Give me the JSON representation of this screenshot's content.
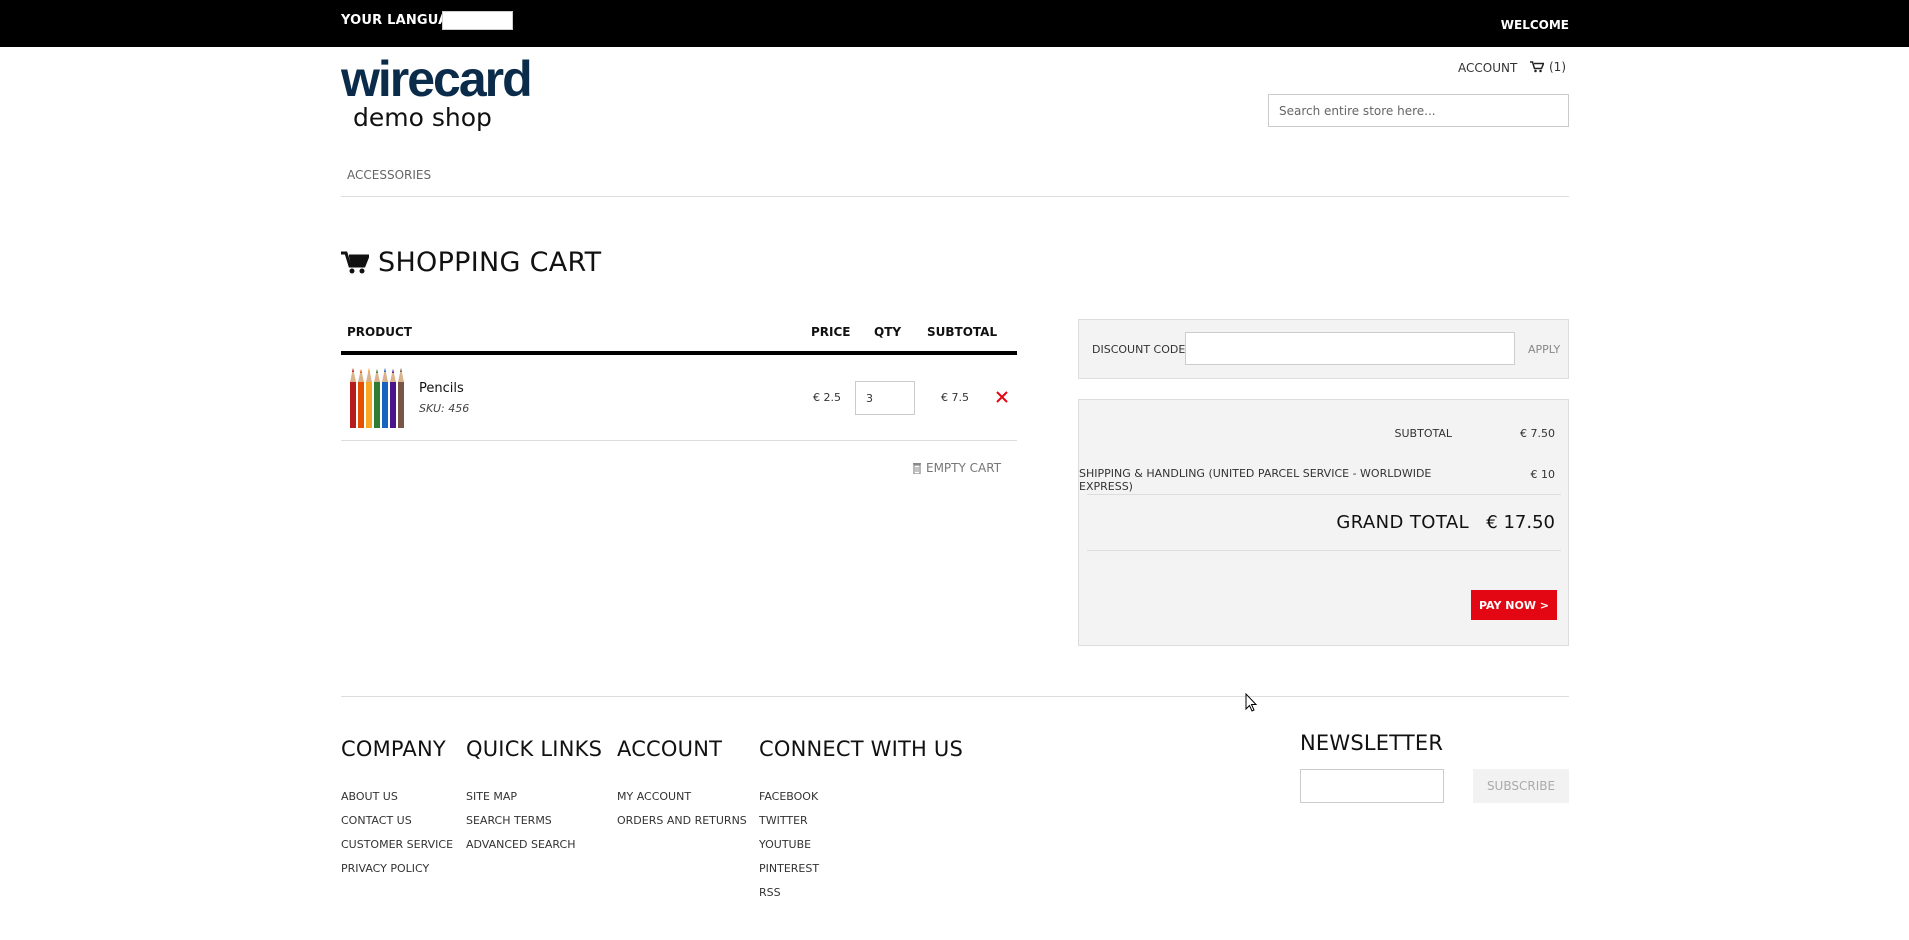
{
  "topbar": {
    "language_label": "YOUR LANGUAGE:",
    "welcome": "WELCOME"
  },
  "logo": {
    "brand": "wirecard",
    "subtitle": "demo shop",
    "brand_color": "#0b2b4a"
  },
  "header": {
    "account_label": "ACCOUNT",
    "cart_count": "(1)",
    "search_placeholder": "Search entire store here..."
  },
  "nav": {
    "items": [
      "ACCESSORIES"
    ]
  },
  "cart": {
    "title": "SHOPPING CART",
    "columns": {
      "product": "PRODUCT",
      "price": "PRICE",
      "qty": "QTY",
      "subtotal": "SUBTOTAL"
    },
    "items": [
      {
        "name": "Pencils",
        "sku": "SKU: 456",
        "price": "€ 2.5",
        "qty": "3",
        "subtotal": "€ 7.5"
      }
    ],
    "empty_cart_label": "EMPTY CART"
  },
  "discount": {
    "label": "DISCOUNT CODES",
    "apply_label": "APPLY"
  },
  "totals": {
    "subtotal_label": "SUBTOTAL",
    "subtotal_value": "€ 7.50",
    "shipping_label": "SHIPPING & HANDLING (UNITED PARCEL SERVICE - WORLDWIDE EXPRESS)",
    "shipping_value": "€ 10",
    "grand_total_label": "GRAND TOTAL",
    "grand_total_value": "€ 17.50",
    "pay_now_label": "PAY NOW >"
  },
  "footer": {
    "company": {
      "title": "COMPANY",
      "links": [
        "ABOUT US",
        "CONTACT US",
        "CUSTOMER SERVICE",
        "PRIVACY POLICY"
      ]
    },
    "quick_links": {
      "title": "QUICK LINKS",
      "links": [
        "SITE MAP",
        "SEARCH TERMS",
        "ADVANCED SEARCH"
      ]
    },
    "account": {
      "title": "ACCOUNT",
      "links": [
        "MY ACCOUNT",
        "ORDERS AND RETURNS"
      ]
    },
    "connect": {
      "title": "CONNECT WITH US",
      "links": [
        "FACEBOOK",
        "TWITTER",
        "YOUTUBE",
        "PINTEREST",
        "RSS"
      ]
    },
    "newsletter": {
      "title": "NEWSLETTER",
      "subscribe_label": "SUBSCRIBE"
    }
  },
  "colors": {
    "accent_red": "#e30613",
    "topbar_bg": "#000000"
  }
}
